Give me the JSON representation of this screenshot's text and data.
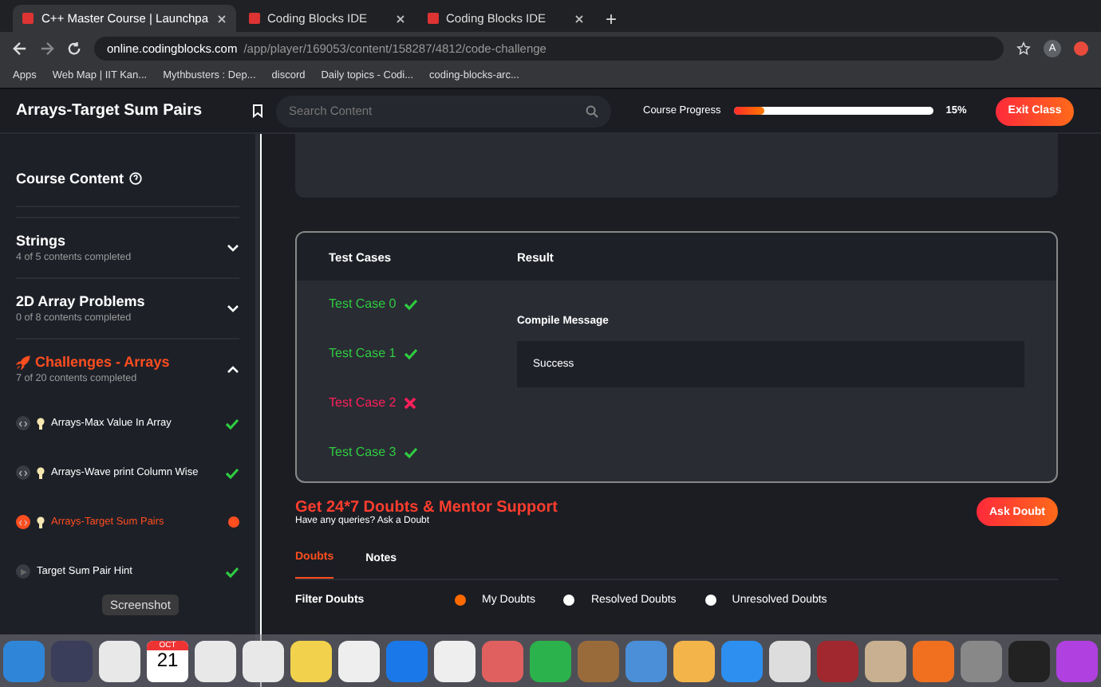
{
  "browser": {
    "tabs": [
      {
        "title": "C++ Master Course | Launchpa",
        "selected": true
      },
      {
        "title": "Coding Blocks IDE",
        "selected": false
      },
      {
        "title": "Coding Blocks IDE",
        "selected": false
      }
    ],
    "new_tab": "+",
    "url": {
      "host": "online.codingblocks.com",
      "path": "/app/player/169053/content/158287/4812/code-challenge"
    },
    "profile": "A",
    "bookmarks": [
      {
        "label": "Apps"
      },
      {
        "label": "Web Map | IIT Kan..."
      },
      {
        "label": "Mythbusters : Dep..."
      },
      {
        "label": "discord"
      },
      {
        "label": "Daily topics - Codi..."
      },
      {
        "label": "coding-blocks-arc..."
      }
    ]
  },
  "header": {
    "title": "Arrays-Target Sum Pairs",
    "search": {
      "placeholder": "Search Content"
    },
    "progress_label": "Course Progress",
    "level": 0.15,
    "reading": "15%",
    "exit_button": "Exit Class"
  },
  "sidebar": {
    "heading": "Course Content",
    "sections": [
      {
        "title": "Strings",
        "subtitle": "4 of 5 contents completed",
        "expanded": false,
        "active": false
      },
      {
        "title": "2D Array Problems",
        "subtitle": "0 of 8 contents completed",
        "expanded": false,
        "active": false
      },
      {
        "title": "Challenges - Arrays",
        "subtitle": "7 of 20 contents completed",
        "expanded": true,
        "active": true
      }
    ],
    "items": [
      {
        "kind": "code",
        "label": "Arrays-Max Value In Array",
        "selected": false
      },
      {
        "kind": "code",
        "label": "Arrays-Wave print Column Wise",
        "selected": false
      },
      {
        "kind": "code",
        "label": "Arrays-Target Sum Pairs",
        "selected": true
      },
      {
        "kind": "video",
        "label": "Target Sum Pair Hint",
        "selected": false
      }
    ]
  },
  "results": {
    "columns": [
      "Test Cases",
      "Result"
    ],
    "test_cases": [
      {
        "label": "Test Case 0",
        "passed": true
      },
      {
        "label": "Test Case 1",
        "passed": true
      },
      {
        "label": "Test Case 2",
        "passed": false
      },
      {
        "label": "Test Case 3",
        "passed": true
      }
    ],
    "compile_label": "Compile Message",
    "compile_message": "Success"
  },
  "support": {
    "title": "Get 24*7 Doubts & Mentor Support",
    "subtitle": "Have any queries? Ask a Doubt",
    "button": "Ask Doubt"
  },
  "tabs": [
    {
      "label": "Doubts",
      "selected": true
    },
    {
      "label": "Notes",
      "selected": false
    }
  ],
  "filter": {
    "label": "Filter Doubts",
    "options": [
      {
        "label": "My Doubts",
        "selected": true
      },
      {
        "label": "Resolved Doubts",
        "selected": false
      },
      {
        "label": "Unresolved Doubts",
        "selected": false
      }
    ]
  },
  "dock": {
    "tooltip": "Screenshot",
    "calendar_month": "OCT",
    "calendar_day": "21"
  }
}
